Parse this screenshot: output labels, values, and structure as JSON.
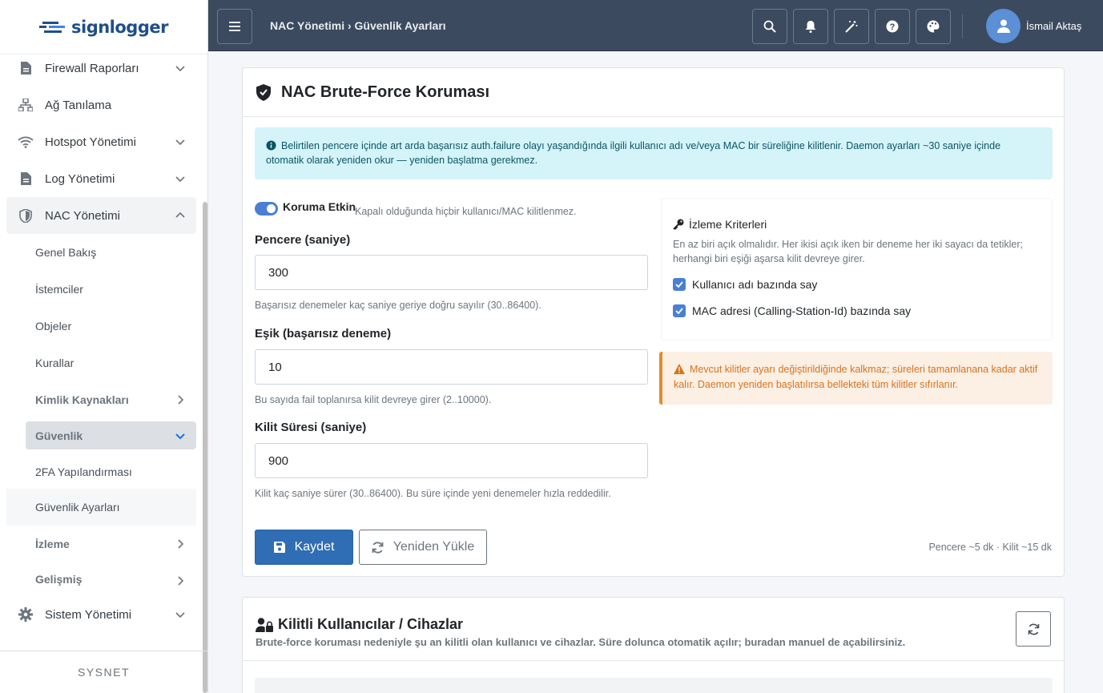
{
  "brand": {
    "name": "signlogger",
    "brand_color": "#1f4e8c"
  },
  "sidebar": {
    "items": [
      {
        "label": "Firewall Raporları",
        "icon": "file-icon",
        "expandable": true
      },
      {
        "label": "Ağ Tanılama",
        "icon": "network-icon",
        "expandable": false
      },
      {
        "label": "Hotspot Yönetimi",
        "icon": "wifi-icon",
        "expandable": true
      },
      {
        "label": "Log Yönetimi",
        "icon": "file-icon",
        "expandable": true
      },
      {
        "label": "NAC Yönetimi",
        "icon": "shield-icon",
        "expandable": true,
        "expanded": true
      },
      {
        "label": "Sistem Yönetimi",
        "icon": "gear-icon",
        "expandable": true
      }
    ],
    "nac_sub": [
      {
        "label": "Genel Bakış"
      },
      {
        "label": "İstemciler"
      },
      {
        "label": "Objeler"
      },
      {
        "label": "Kurallar"
      },
      {
        "label": "Kimlik Kaynakları"
      },
      {
        "label": "Güvenlik"
      },
      {
        "label": "2FA Yapılandırması"
      },
      {
        "label": "Güvenlik Ayarları"
      },
      {
        "label": "İzleme"
      },
      {
        "label": "Gelişmiş"
      }
    ],
    "footer": "SYSNET"
  },
  "topbar": {
    "breadcrumb": "NAC Yönetimi › Güvenlik Ayarları",
    "username": "İsmail Aktaş",
    "buttons": [
      "menu-icon",
      "search-icon",
      "bell-icon",
      "magic-wand-icon",
      "help-icon",
      "palette-icon"
    ]
  },
  "card1": {
    "title": "NAC Brute-Force Koruması",
    "info": "Belirtilen pencere içinde art arda başarısız auth.failure olayı yaşandığında ilgili kullanıcı adı ve/veya MAC bir süreliğine kilitlenir. Daemon ayarları ~30 saniye içinde otomatik olarak yeniden okur — yeniden başlatma gerekmez.",
    "toggle_label": "Koruma Etkin",
    "toggle_help": "Kapalı olduğunda hiçbir kullanıcı/MAC kilitlenmez.",
    "toggle_on": true,
    "window": {
      "label": "Pencere (saniye)",
      "value": "300",
      "help": "Başarısız denemeler kaç saniye geriye doğru sayılır (30..86400)."
    },
    "threshold": {
      "label": "Eşik (başarısız deneme)",
      "value": "10",
      "help": "Bu sayıda fail toplanırsa kilit devreye girer (2..10000)."
    },
    "lock": {
      "label": "Kilit Süresi (saniye)",
      "value": "900",
      "help": "Kilit kaç saniye sürer (30..86400). Bu süre içinde yeni denemeler hızla reddedilir."
    },
    "criteria": {
      "title": "İzleme Kriterleri",
      "help": "En az biri açık olmalıdır. Her ikisi açık iken bir deneme her iki sayacı da tetikler; herhangi biri eşiği aşarsa kilit devreye girer.",
      "user": "Kullanıcı adı bazında say",
      "mac": "MAC adresi (Calling-Station-Id) bazında say",
      "user_checked": true,
      "mac_checked": true
    },
    "warning": "Mevcut kilitler ayarı değiştirildiğinde kalkmaz; süreleri tamamlanana kadar aktif kalır. Daemon yeniden başlatılırsa bellekteki tüm kilitler sıfırlanır.",
    "save_label": "Kaydet",
    "reload_label": "Yeniden Yükle",
    "summary": "Pencere ~5 dk · Kilit ~15 dk"
  },
  "card2": {
    "title": "Kilitli Kullanıcılar / Cihazlar",
    "subtitle": "Brute-force koruması nedeniyle şu an kilitli olan kullanıcı ve cihazlar. Süre dolunca otomatik açılır; buradan manuel de açabilirsiniz."
  },
  "colors": {
    "accent": "#2f6db5",
    "topbar": "#3b4a5e",
    "info_bg": "#d4f4fa",
    "warn_bg": "#fcefe4",
    "warn_text": "#d9731b"
  }
}
